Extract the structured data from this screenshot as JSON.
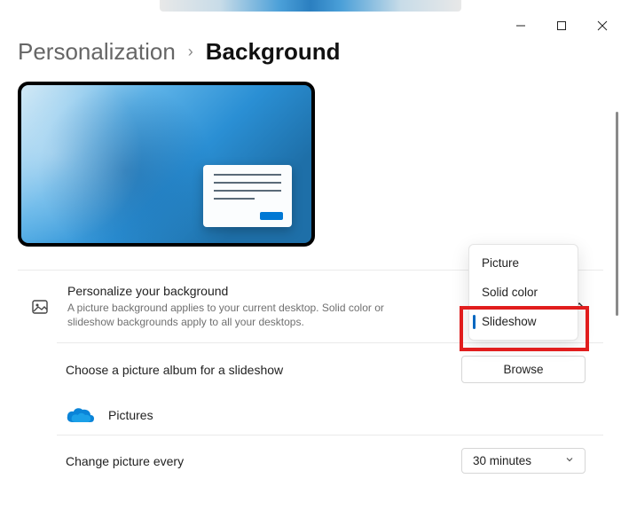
{
  "window": {
    "minimize": "−",
    "maximize": "□",
    "close": "✕"
  },
  "breadcrumb": {
    "parent": "Personalization",
    "separator": "›",
    "current": "Background"
  },
  "dropdown": {
    "items": [
      "Picture",
      "Solid color",
      "Slideshow"
    ],
    "selected": "Slideshow"
  },
  "settings": {
    "personalize": {
      "title": "Personalize your background",
      "desc": "A picture background applies to your current desktop. Solid color or slideshow backgrounds apply to all your desktops."
    },
    "album": {
      "title": "Choose a picture album for a slideshow",
      "browse": "Browse",
      "folder": "Pictures"
    },
    "interval": {
      "title": "Change picture every",
      "value": "30 minutes"
    }
  }
}
